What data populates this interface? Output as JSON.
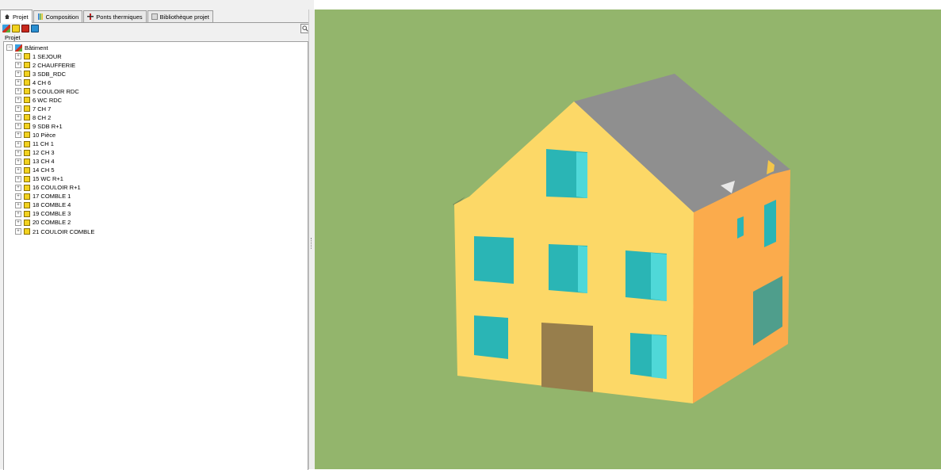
{
  "tabs": [
    {
      "label": "Projet",
      "icon": "house-icon",
      "active": true
    },
    {
      "label": "Composition",
      "icon": "layers-icon",
      "active": false
    },
    {
      "label": "Ponts thermiques",
      "icon": "thermal-bridge-icon",
      "active": false
    },
    {
      "label": "Bibliothèque projet",
      "icon": "library-icon",
      "active": false
    }
  ],
  "toolbar": {
    "icons": [
      "building-icon",
      "room-icon",
      "zone-icon",
      "window-icon"
    ],
    "search_icon": "magnifier-icon"
  },
  "panel_label": "Projet",
  "tree": {
    "root": {
      "label": "Bâtiment",
      "icon": "building-icon"
    },
    "items": [
      {
        "label": "1 SEJOUR"
      },
      {
        "label": "2 CHAUFFERIE"
      },
      {
        "label": "3 SDB_RDC"
      },
      {
        "label": "4 CH 6"
      },
      {
        "label": "5 COULOIR RDC"
      },
      {
        "label": "6 WC RDC"
      },
      {
        "label": "7 CH 7"
      },
      {
        "label": "8 CH 2"
      },
      {
        "label": "9 SDB R+1"
      },
      {
        "label": "10 Pièce"
      },
      {
        "label": "11 CH 1"
      },
      {
        "label": "12 CH 3"
      },
      {
        "label": "13 CH 4"
      },
      {
        "label": "14 CH 5"
      },
      {
        "label": "15 WC R+1"
      },
      {
        "label": "16 COULOIR R+1"
      },
      {
        "label": "17 COMBLE 1"
      },
      {
        "label": "18 COMBLE 4"
      },
      {
        "label": "19 COMBLE 3"
      },
      {
        "label": "20 COMBLE 2"
      },
      {
        "label": "21 COULOIR COMBLE"
      }
    ]
  },
  "viewport": {
    "colors": {
      "ground": "#93b56c",
      "front_wall": "#fcd867",
      "side_wall": "#fbab4c",
      "roof": "#8f8f8f",
      "window": "#2ab5b5",
      "door": "#977e4c"
    }
  }
}
